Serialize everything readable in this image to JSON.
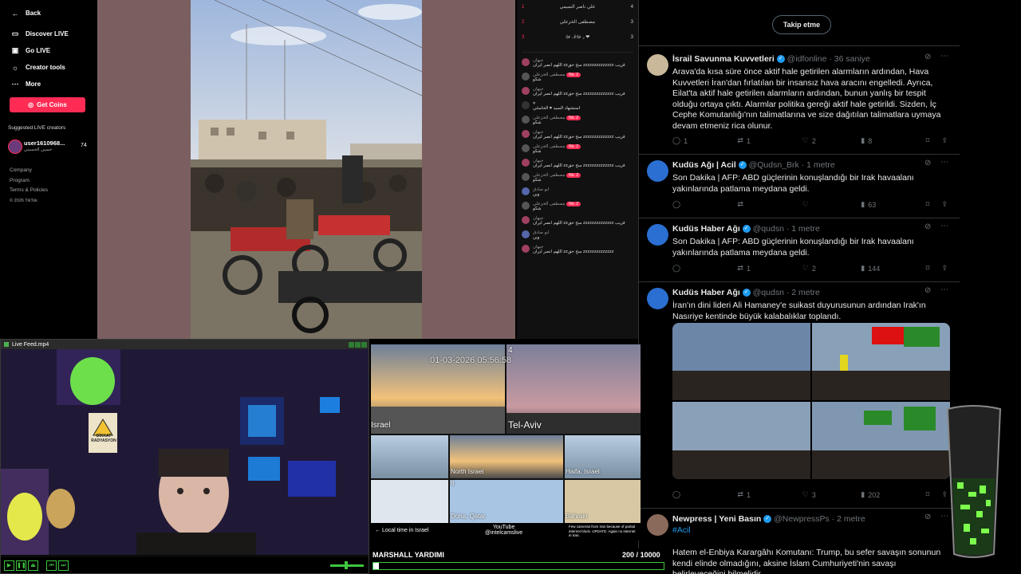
{
  "tiktok": {
    "nav": [
      {
        "label": "Back",
        "icon": "arrow-left-icon"
      },
      {
        "label": "Discover LIVE",
        "icon": "live-tv-icon"
      },
      {
        "label": "Go LIVE",
        "icon": "camera-icon"
      },
      {
        "label": "Creator tools",
        "icon": "lightbulb-icon"
      },
      {
        "label": "More",
        "icon": "more-dots-icon"
      }
    ],
    "get_coins": "Get Coins",
    "suggested_title": "Suggested LIVE creators",
    "creator": {
      "name": "user1610968...",
      "sub": "حسين الحسيني",
      "count": "74"
    },
    "footer": [
      "Company",
      "Program",
      "Terms & Policies",
      "© 2026 TikTok"
    ]
  },
  "chat": {
    "top": [
      {
        "name": "علي ناصر التميمي",
        "count": "4"
      },
      {
        "name": "مصطفى الخزعلي",
        "count": "3"
      },
      {
        "name": "و ﷻآ؋ۦ ﷻ ❤",
        "count": "3"
      }
    ],
    "items": [
      {
        "user": "جيهان",
        "text": "اللهم انصر ايران zzسخ حق zzzzzzzzzzzzzz قريب"
      },
      {
        "user": "مصطفى الخزعلي",
        "text": "شكو",
        "badge": "No. 2"
      },
      {
        "user": "جيهان",
        "text": "اللهم انصر ايران zzسخ حق zzzzzzzzzzzzzz قريب"
      },
      {
        "user": "♥",
        "text": "استشهاد السيد ♥ الخامنئي"
      },
      {
        "user": "مصطفى الخزعلي",
        "text": "شكو",
        "badge": "No. 2"
      },
      {
        "user": "جيهان",
        "text": "اللهم انصر ايران zzسخ حق zzzzzzzzzzzzzz قريب"
      },
      {
        "user": "مصطفى الخزعلي",
        "text": "شكو",
        "badge": "No. 2"
      },
      {
        "user": "جيهان",
        "text": "اللهم انصر ايران zzسخ حق zzzzzzzzzzzzzz قريب"
      },
      {
        "user": "مصطفى الخزعلي",
        "text": "شكو",
        "badge": "No. 2"
      },
      {
        "user": "ابو صادق",
        "text": "وين"
      },
      {
        "user": "مصطفى الخزعلي",
        "text": "شكو",
        "badge": "No. 2"
      },
      {
        "user": "جيهان",
        "text": "اللهم انصر ايران zzسخ حق zzzzzzzzzzzzzz قريب"
      },
      {
        "user": "ابو صادق",
        "text": "وين"
      },
      {
        "user": "جيهان",
        "text": "اللهم انصر ايران zzسخ حق zzzzzzzzzzzzzz"
      }
    ]
  },
  "twitter": {
    "follow_button": "Takip etme",
    "tweets": [
      {
        "name": "İsrail Savunma Kuvvetleri",
        "handle": "@idfonline",
        "time": "· 36 saniye",
        "text": "Arava'da kısa süre önce aktif hale getirilen alarmların ardından, Hava Kuvvetleri İran'dan fırlatılan bir insansız hava aracını engelledi. Ayrıca, Eilat'ta aktif hale getirilen alarmların ardından, bunun yanlış bir tespit olduğu ortaya çıktı. Alarmlar politika gereği aktif hale getirildi. Sizden, İç Cephe Komutanlığı'nın talimatlarına ve size dağıtılan talimatlara uymaya devam etmeniz rica olunur.",
        "replies": "1",
        "retweets": "1",
        "likes": "2",
        "views": "8"
      },
      {
        "name": "Kudüs Ağı | Acil",
        "handle": "@Qudsn_Brk",
        "time": "· 1 metre",
        "text": "Son Dakika | AFP: ABD güçlerinin konuşlandığı bir Irak havaalanı yakınlarında patlama meydana geldi.",
        "replies": "",
        "retweets": "",
        "likes": "",
        "views": "63"
      },
      {
        "name": "Kudüs Haber Ağı",
        "handle": "@qudsn",
        "time": "· 1 metre",
        "text": "Son Dakika | AFP: ABD güçlerinin konuşlandığı bir Irak havaalanı yakınlarında patlama meydana geldi.",
        "replies": "",
        "retweets": "1",
        "likes": "2",
        "views": "144"
      },
      {
        "name": "Kudüs Haber Ağı",
        "handle": "@qudsn",
        "time": "· 2 metre",
        "text": "İran'ın dini lideri Ali Hamaney'e suikast duyurusunun ardından Irak'ın Nasıriye kentinde büyük kalabalıklar toplandı.",
        "replies": "",
        "retweets": "1",
        "likes": "3",
        "views": "202"
      },
      {
        "name": "Newpress | Yeni Basın",
        "handle": "@NewpressPs",
        "time": "· 2 metre",
        "tag": "#Acil",
        "text": "Hatem el-Enbiya Karargâhı Komutanı: Trump, bu sefer savaşın sonunun kendi elinde olmadığını, aksine İslam Cumhuriyeti'nin savaşı belirleyeceğini bilmelidir.",
        "replies": "",
        "retweets": "",
        "likes": "",
        "views": ""
      }
    ]
  },
  "webcam": {
    "title": "Live Feed.mp4",
    "sign_line1": "DİKKAT",
    "sign_line2": "RADYASYON"
  },
  "cams": {
    "timestamp": "01-03-2026 05:56:58",
    "labels": {
      "israel": "Israel",
      "tel_aviv": "Tel-Aviv",
      "north_israel": "North Israel",
      "haifa": "Haifa, Israel",
      "doha": "Doha, Qatar",
      "bahrain": "Bahrain",
      "num4": "4",
      "num8": "8"
    },
    "bottom_left": "← Local time in Israel",
    "youtube": "YouTube",
    "channel": "@intelcamslive",
    "note": "Few cameras from Iran because of partial internet block. UPDATE: Again no internet in Iran."
  },
  "marshall": {
    "title": "MARSHALL YARDIMI",
    "current": "200",
    "goal": "10000",
    "progress": 0.02
  }
}
